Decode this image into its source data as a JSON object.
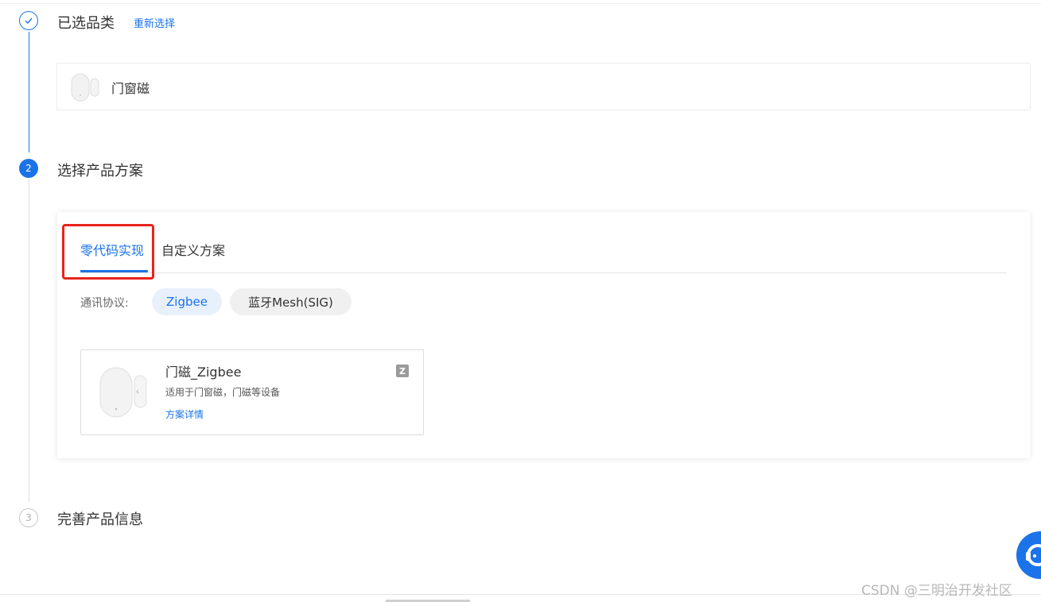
{
  "steps": {
    "step1": {
      "title": "已选品类",
      "reselect_label": "重新选择",
      "status": "done"
    },
    "step2": {
      "number": "2",
      "title": "选择产品方案",
      "status": "active"
    },
    "step3": {
      "number": "3",
      "title": "完善产品信息",
      "status": "pending"
    }
  },
  "selected_category": {
    "name": "门窗磁",
    "icon": "door-sensor-image"
  },
  "solution": {
    "tabs": [
      {
        "label": "零代码实现",
        "active": true
      },
      {
        "label": "自定义方案",
        "active": false
      }
    ],
    "protocol_label": "通讯协议:",
    "protocols": [
      {
        "label": "Zigbee",
        "selected": true
      },
      {
        "label": "蓝牙Mesh(SIG)",
        "selected": false
      }
    ],
    "cards": [
      {
        "title": "门磁_Zigbee",
        "description": "适用于门窗磁，门磁等设备",
        "link_label": "方案详情",
        "badge": "Z",
        "icon": "door-sensor-image"
      }
    ]
  },
  "watermark": "CSDN @三明治开发社区",
  "colors": {
    "accent": "#1a73e8",
    "highlight": "#e8231c"
  }
}
